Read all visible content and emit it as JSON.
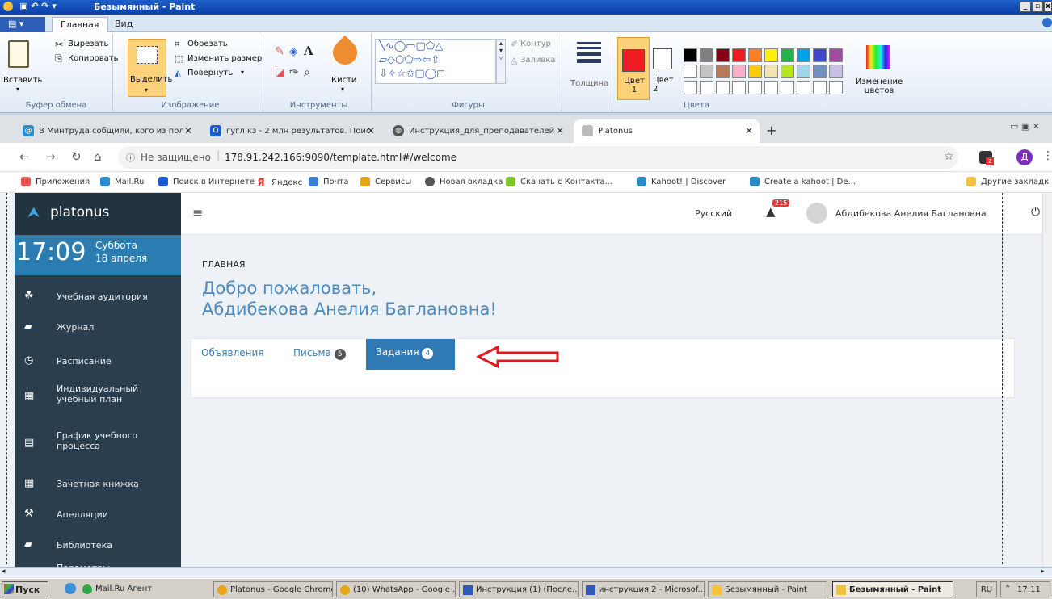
{
  "paint": {
    "title": "Безымянный - Paint",
    "tabs": [
      "Главная",
      "Вид"
    ],
    "clipboard": {
      "paste": "Вставить",
      "cut": "Вырезать",
      "copy": "Копировать",
      "group": "Буфер обмена"
    },
    "image": {
      "select": "Выделить",
      "crop": "Обрезать",
      "resize": "Изменить размер",
      "rotate": "Повернуть",
      "group": "Изображение"
    },
    "tools": {
      "group": "Инструменты",
      "brushes": "Кисти"
    },
    "shapes": {
      "outline": "Контур",
      "fill": "Заливка",
      "group": "Фигуры"
    },
    "size": {
      "label": "Толщина"
    },
    "colors": {
      "color1": "Цвет 1",
      "color2": "Цвет 2",
      "edit": "Изменение цветов",
      "group": "Цвета",
      "palette_row1": [
        "#000000",
        "#7f7f7f",
        "#880015",
        "#ed1c24",
        "#ff7f27",
        "#fff200",
        "#22b14c",
        "#00a2e8",
        "#3f48cc",
        "#a349a4"
      ],
      "palette_row2": [
        "#ffffff",
        "#c3c3c3",
        "#b97a57",
        "#ffaec9",
        "#ffc90e",
        "#efe4b0",
        "#b5e61d",
        "#99d9ea",
        "#7092be",
        "#c8bfe7"
      ]
    }
  },
  "browser": {
    "tabs": [
      {
        "title": "В Минтруда собщили, кого из пол"
      },
      {
        "title": "гугл кз - 2 млн результатов. Поис"
      },
      {
        "title": "Инструкция_для_преподавателей"
      },
      {
        "title": "Platonus"
      }
    ],
    "address": {
      "security": "Не защищено",
      "url": "178.91.242.166:9090/template.html#/welcome"
    },
    "bookmarks": [
      "Приложения",
      "Mail.Ru",
      "Поиск в Интернете",
      "Яндекс",
      "Почта",
      "Сервисы",
      "Новая вкладка",
      "Скачать с Контакта...",
      "Kahoot! | Discover",
      "Create a kahoot | De...",
      "Другие закладк"
    ],
    "profile_initial": "Д",
    "ext_badge": "2"
  },
  "platonus": {
    "logo": "platonus",
    "time": "17:09",
    "day": "Суббота",
    "date": "18 апреля",
    "language": "Русский",
    "notifications": "215",
    "user": "Абдибекова Анелия Баглановна",
    "menu": [
      "Учебная аудитория",
      "Журнал",
      "Расписание",
      "Индивидуальный учебный план",
      "График учебного процесса",
      "Зачетная книжка",
      "Апелляции",
      "Библиотека",
      "Параметры"
    ],
    "breadcrumb": "ГЛАВНАЯ",
    "welcome_line1": "Добро пожаловать,",
    "welcome_line2": "Абдибекова Анелия Баглановна!",
    "tabs": [
      {
        "label": "Объявления"
      },
      {
        "label": "Письма",
        "count": "5"
      },
      {
        "label": "Задания",
        "count": "4"
      }
    ]
  },
  "taskbar": {
    "start": "Пуск",
    "items": [
      "Mail.Ru Агент",
      "Platonus - Google Chrome",
      "(10) WhatsApp - Google ...",
      "Инструкция (1) (После...",
      "инструкция 2 - Microsof...",
      "Безымянный - Paint",
      "Безымянный - Paint"
    ],
    "lang": "RU",
    "clock": "17:11"
  },
  "colors": {
    "accent": "#2b7db1",
    "sidebar": "#2a3e4e",
    "arrow": "#e0191f"
  }
}
